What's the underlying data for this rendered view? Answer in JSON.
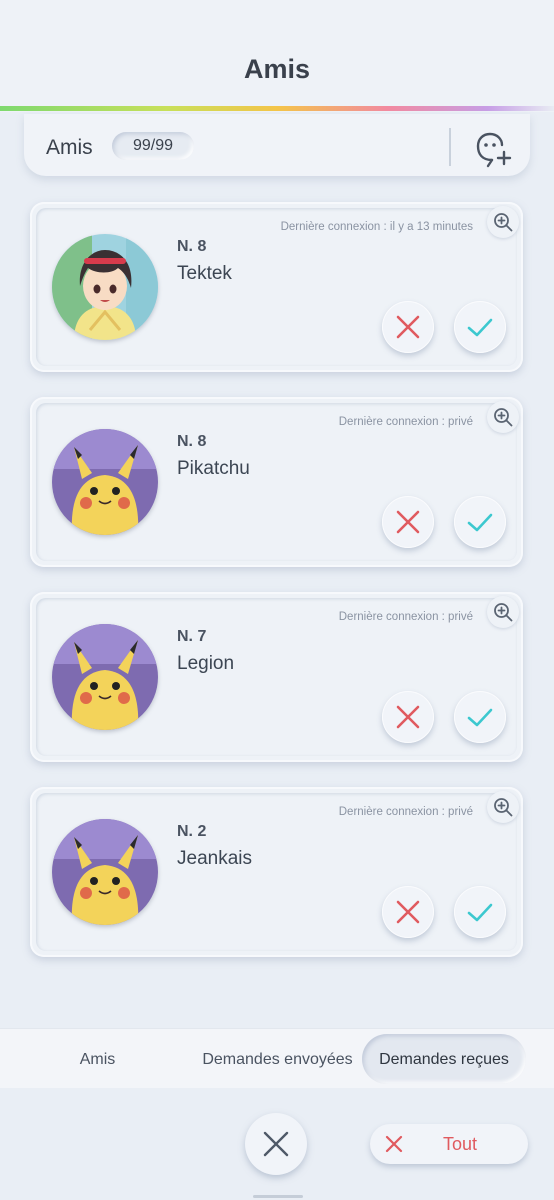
{
  "header": {
    "title": "Amis"
  },
  "summary": {
    "label": "Amis",
    "count": "99/99"
  },
  "requests": [
    {
      "rank": "N. 8",
      "name": "Tektek",
      "last_seen": "Dernière connexion : il y a 13 minutes",
      "avatar": "trainer-girl"
    },
    {
      "rank": "N. 8",
      "name": "Pikatchu",
      "last_seen": "Dernière connexion : privé",
      "avatar": "pikachu"
    },
    {
      "rank": "N. 7",
      "name": "Legion",
      "last_seen": "Dernière connexion : privé",
      "avatar": "pikachu"
    },
    {
      "rank": "N. 2",
      "name": "Jeankais",
      "last_seen": "Dernière connexion : privé",
      "avatar": "pikachu"
    }
  ],
  "tabs": {
    "friends": "Amis",
    "sent": "Demandes envoyées",
    "received": "Demandes reçues",
    "active": "received"
  },
  "footer": {
    "reject_all": "Tout"
  },
  "colors": {
    "reject": "#e05a5f",
    "accept": "#3cc8cf",
    "accent_gradient": [
      "#7ed96f",
      "#f4c54a",
      "#f28aa0",
      "#c79ee6"
    ]
  },
  "icons": {
    "add_friend": "add-friend-icon",
    "zoom": "zoom-in-icon",
    "reject": "x-icon",
    "accept": "check-icon",
    "close": "close-icon"
  }
}
